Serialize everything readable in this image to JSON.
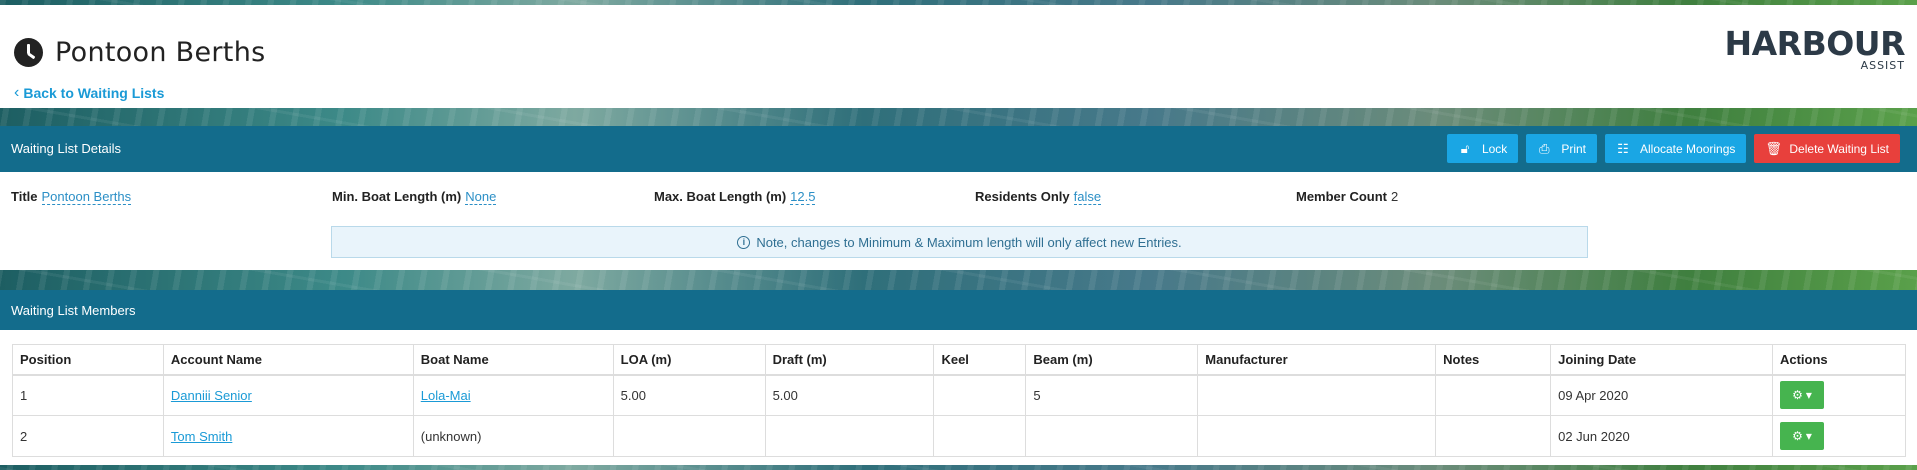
{
  "header": {
    "title": "Pontoon Berths",
    "back_link": "Back to Waiting Lists",
    "logo_word": "HARBOUR",
    "logo_sub": "ASSIST"
  },
  "details": {
    "panel_title": "Waiting List Details",
    "buttons": {
      "lock": "Lock",
      "print": "Print",
      "allocate": "Allocate Moorings",
      "delete": "Delete Waiting List"
    },
    "fields": {
      "title_label": "Title",
      "title_value": "Pontoon Berths",
      "min_label": "Min. Boat Length (m)",
      "min_value": "None",
      "max_label": "Max. Boat Length (m)",
      "max_value": "12.5",
      "residents_label": "Residents Only",
      "residents_value": "false",
      "count_label": "Member Count",
      "count_value": "2"
    },
    "note": "Note, changes to Minimum & Maximum length will only affect new Entries."
  },
  "members": {
    "panel_title": "Waiting List Members",
    "columns": [
      "Position",
      "Account Name",
      "Boat Name",
      "LOA (m)",
      "Draft (m)",
      "Keel",
      "Beam (m)",
      "Manufacturer",
      "Notes",
      "Joining Date",
      "Actions"
    ],
    "rows": [
      {
        "position": "1",
        "account": "Danniii Senior",
        "boat": "Lola-Mai",
        "loa": "5.00",
        "draft": "5.00",
        "keel": "",
        "beam": "5",
        "manufacturer": "",
        "notes": "",
        "joining": "09 Apr 2020"
      },
      {
        "position": "2",
        "account": "Tom Smith",
        "boat": "(unknown)",
        "loa": "",
        "draft": "",
        "keel": "",
        "beam": "",
        "manufacturer": "",
        "notes": "",
        "joining": "02 Jun 2020"
      }
    ]
  },
  "colors": {
    "panel_header": "#136c8c",
    "primary_button": "#1aa6e4",
    "danger_button": "#e8403c",
    "action_button": "#46b44f",
    "link": "#1a9ad6"
  }
}
